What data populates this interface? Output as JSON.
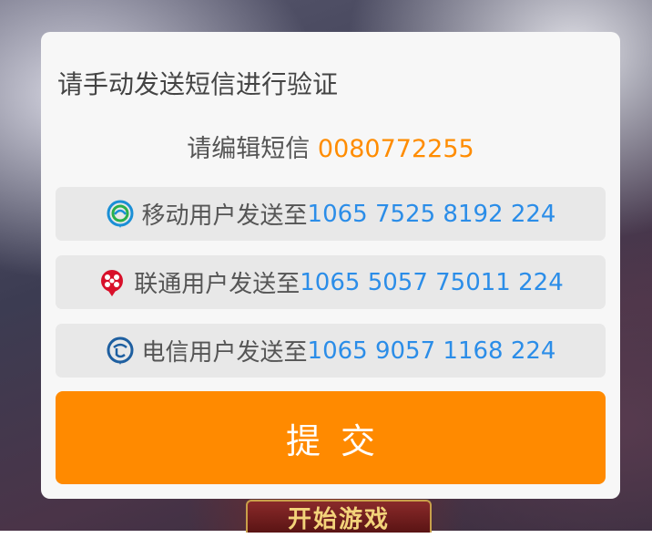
{
  "background": {
    "banner_text": "开始游戏"
  },
  "dialog": {
    "title": "请手动发送短信进行验证",
    "edit_prefix": "请编辑短信 ",
    "sms_code": "0080772255",
    "carriers": [
      {
        "name": "移动",
        "label": "移动用户发送至",
        "number": "1065 7525 8192 224",
        "icon": "china-mobile-logo-icon",
        "color": "#1a8fd6"
      },
      {
        "name": "联通",
        "label": "联通用户发送至",
        "number": "1065 5057 75011 224",
        "icon": "china-unicom-logo-icon",
        "color": "#d8102a"
      },
      {
        "name": "电信",
        "label": "电信用户发送至",
        "number": "1065 9057 1168 224",
        "icon": "china-telecom-logo-icon",
        "color": "#1e5fa0"
      }
    ],
    "submit_label": "提交"
  },
  "colors": {
    "accent_orange": "#ff8a00",
    "code_orange": "#ff8c00",
    "number_blue": "#2b8de8",
    "dialog_bg": "#f7f7f7",
    "row_bg": "#e8e8e8"
  }
}
